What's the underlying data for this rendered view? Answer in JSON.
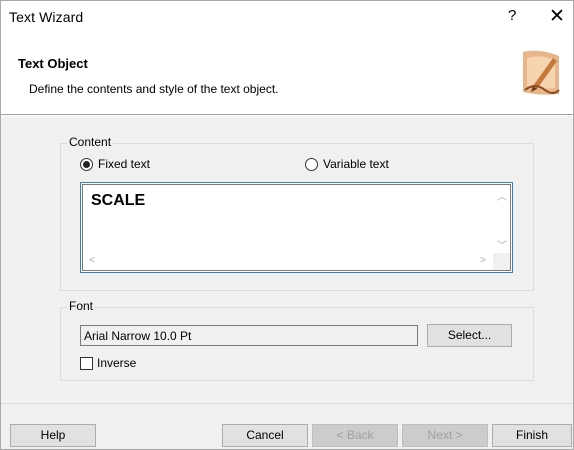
{
  "window": {
    "title": "Text Wizard",
    "help_glyph": "?",
    "close_glyph": "✕"
  },
  "header": {
    "title": "Text Object",
    "subtitle": "Define the contents and style of the text object.",
    "art_icon": "wizard-pen-icon"
  },
  "content_group": {
    "label": "Content",
    "fixed_text_label": "Fixed text",
    "variable_text_label": "Variable text",
    "selected_option": "Fixed text",
    "text_value": "SCALE"
  },
  "font_group": {
    "label": "Font",
    "font_value": "Arial Narrow 10.0 Pt",
    "select_label": "Select...",
    "inverse_label": "Inverse",
    "inverse_checked": false
  },
  "footer": {
    "help_label": "Help",
    "cancel_label": "Cancel",
    "back_label": "< Back",
    "next_label": "Next >",
    "finish_label": "Finish"
  },
  "colors": {
    "focus_border": "#3c7fb1",
    "dialog_bg": "#f0f0f0",
    "disabled_text": "#a0a0a0"
  }
}
